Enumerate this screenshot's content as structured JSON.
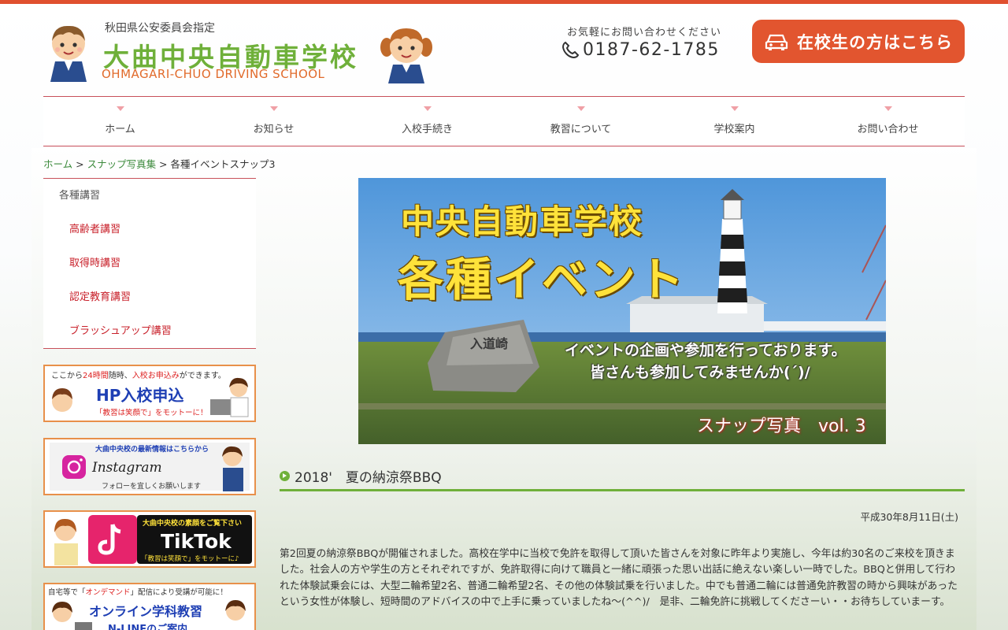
{
  "header": {
    "logo_sub": "秋田県公安委員会指定",
    "logo_title": "大曲中央自動車学校",
    "logo_en": "OHMAGARI-CHUO DRIVING SCHOOL",
    "contact_caption": "お気軽にお問い合わせください",
    "phone": "0187-62-1785",
    "student_button": "在校生の方はこちら"
  },
  "nav": {
    "items": [
      "ホーム",
      "お知らせ",
      "入校手続き",
      "教習について",
      "学校案内",
      "お問い合わせ"
    ]
  },
  "breadcrumb": {
    "home": "ホーム",
    "sep1": " > ",
    "album": "スナップ写真集",
    "sep2": " > ",
    "current": "各種イベントスナップ3"
  },
  "sidebar": {
    "heading": "各種講習",
    "items": [
      "高齢者講習",
      "取得時講習",
      "認定教育講習",
      "ブラッシュアップ講習"
    ],
    "banners": {
      "apply_top_a": "ここから",
      "apply_top_b": "24時間",
      "apply_top_c": "随時、",
      "apply_top_d": "入校お申込み",
      "apply_top_e": "ができます。",
      "apply_main": "HP入校申込",
      "apply_motto": "「教習は笑顔で」をモットーに！",
      "insta_top": "大曲中央校の最新情報はこちらから",
      "insta_main": "Instagram",
      "insta_bottom": "フォローを宜しくお願いします",
      "tiktok_top": "大曲中央校の素顔をご覧下さい",
      "tiktok_main": "TikTok",
      "tiktok_motto": "「教習は笑顔で」をモットーに♪",
      "online_top_a": "自宅等で「",
      "online_top_b": "オンデマンド",
      "online_top_c": "」配信により受講が可能に！",
      "online_main": "オンライン学科教習",
      "online_sub": "N-LINEのご案内"
    }
  },
  "hero": {
    "line1": "中央自動車学校",
    "line2": "各種イベント",
    "line3": "イベントの企画や参加を行っております。",
    "line4": "皆さんも参加してみませんか(´)/",
    "stone": "入道崎",
    "snap": "スナップ写真　vol. 3"
  },
  "article": {
    "title": "2018'　夏の納涼祭BBQ",
    "date": "平成30年8月11日(土)",
    "body": "第2回夏の納涼祭BBQが開催されました。高校在学中に当校で免許を取得して頂いた皆さんを対象に昨年より実施し、今年は約30名のご来校を頂きました。社会人の方や学生の方とそれぞれですが、免許取得に向けて職員と一緒に頑張った思い出話に絶えない楽しい一時でした。BBQと併用して行われた体験試乗会には、大型二輪希望2名、普通二輪希望2名、その他の体験試乗を行いました。中でも普通二輪には普通免許教習の時から興味があったという女性が体験し、短時間のアドバイスの中で上手に乗っていましたね～(^^)/　是非、二輪免許に挑戦してくださーい・・お待ちしていまーす。"
  },
  "colors": {
    "accent_red": "#e0502f",
    "brand_green": "#6fb03a",
    "nav_line": "#c8505a",
    "side_link": "#c8202a"
  }
}
